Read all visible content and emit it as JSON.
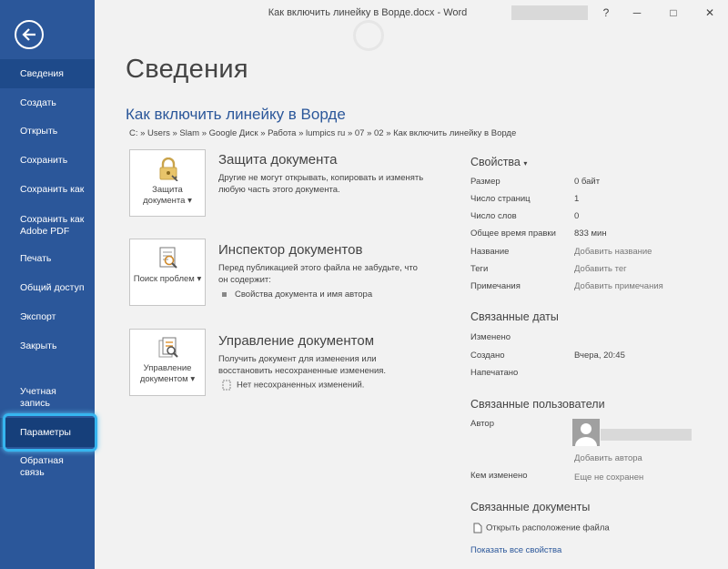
{
  "window": {
    "title": "Как включить линейку в Ворде.docx - Word",
    "help_glyph": "?",
    "minimize_glyph": "─",
    "restore_glyph": "□",
    "close_glyph": "✕"
  },
  "sidebar": {
    "items": [
      {
        "label": "Сведения"
      },
      {
        "label": "Создать"
      },
      {
        "label": "Открыть"
      },
      {
        "label": "Сохранить"
      },
      {
        "label": "Сохранить как"
      },
      {
        "label": "Сохранить как Adobe PDF"
      },
      {
        "label": "Печать"
      },
      {
        "label": "Общий доступ"
      },
      {
        "label": "Экспорт"
      },
      {
        "label": "Закрыть"
      },
      {
        "label": "Учетная запись"
      },
      {
        "label": "Параметры"
      },
      {
        "label": "Обратная связь"
      }
    ]
  },
  "main": {
    "page_title": "Сведения",
    "doc_title": "Как включить линейку в Ворде",
    "doc_path": "C: » Users » Slam » Google Диск » Работа » lumpics ru » 07 » 02 » Как включить линейку в Ворде",
    "sections": [
      {
        "button_label": "Защита документа",
        "title": "Защита документа",
        "desc": "Другие не могут открывать, копировать и изменять любую часть этого документа."
      },
      {
        "button_label": "Поиск проблем",
        "title": "Инспектор документов",
        "desc": "Перед публикацией этого файла не забудьте, что он содержит:",
        "bullet": "Свойства документа и имя автора"
      },
      {
        "button_label": "Управление документом",
        "title": "Управление документом",
        "desc": "Получить документ для изменения или восстановить несохраненные изменения.",
        "bullet": "Нет несохраненных изменений."
      }
    ]
  },
  "properties": {
    "header": "Свойства",
    "rows": [
      {
        "label": "Размер",
        "value": "0 байт"
      },
      {
        "label": "Число страниц",
        "value": "1"
      },
      {
        "label": "Число слов",
        "value": "0"
      },
      {
        "label": "Общее время правки",
        "value": "833 мин"
      },
      {
        "label": "Название",
        "value": "Добавить название"
      },
      {
        "label": "Теги",
        "value": "Добавить тег"
      },
      {
        "label": "Примечания",
        "value": "Добавить примечания"
      }
    ],
    "dates_header": "Связанные даты",
    "dates": [
      {
        "label": "Изменено",
        "value": ""
      },
      {
        "label": "Создано",
        "value": "Вчера, 20:45"
      },
      {
        "label": "Напечатано",
        "value": ""
      }
    ],
    "people_header": "Связанные пользователи",
    "author_label": "Автор",
    "add_author": "Добавить автора",
    "modified_by_label": "Кем изменено",
    "modified_by_value": "Еще не сохранен",
    "docs_header": "Связанные документы",
    "open_location": "Открыть расположение файла",
    "show_all": "Показать все свойства"
  },
  "colors": {
    "sidebar_bg": "#2b579a",
    "accent": "#2b579a",
    "highlight_outline": "#36b5ef"
  },
  "icons": {
    "back": "back-arrow-icon",
    "lock": "lock-key-icon",
    "inspect": "inspect-document-icon",
    "manage": "manage-document-icon"
  }
}
